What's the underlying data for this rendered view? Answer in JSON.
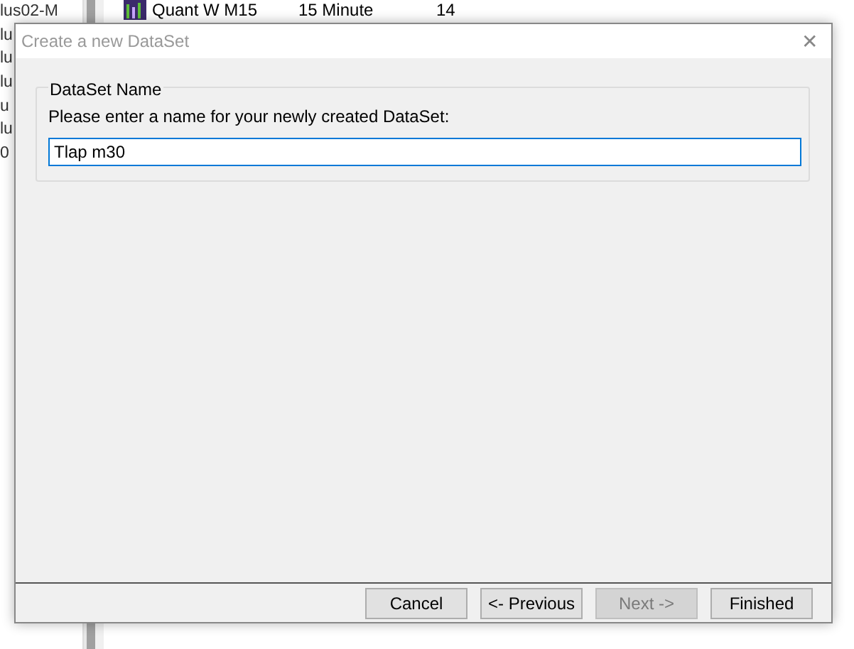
{
  "background": {
    "left_list": [
      "lus02-M",
      "lu",
      "lu",
      "lu",
      "u",
      "lu",
      "0"
    ],
    "row": {
      "name": "Quant W M15",
      "interval": "15 Minute",
      "column_3": "14"
    }
  },
  "dialog": {
    "title": "Create a new DataSet",
    "close": "✕",
    "group": {
      "title": "DataSet Name",
      "prompt": "Please enter a name for your newly created DataSet:",
      "value": "Tlap m30"
    },
    "buttons": [
      {
        "label": "Cancel",
        "disabled": false
      },
      {
        "label": "<- Previous",
        "disabled": false
      },
      {
        "label": "Next ->",
        "disabled": true
      },
      {
        "label": "Finished",
        "disabled": false
      }
    ]
  }
}
